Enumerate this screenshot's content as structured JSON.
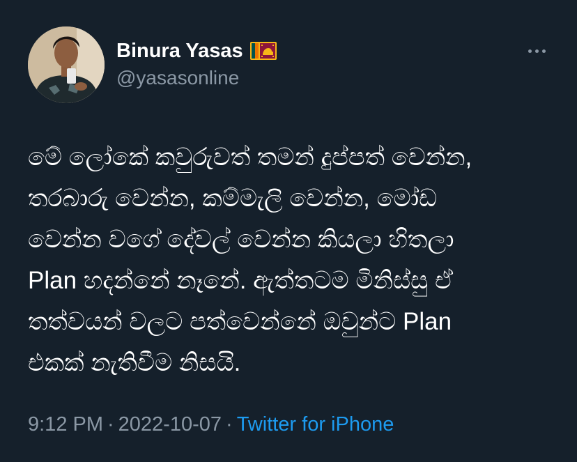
{
  "author": {
    "display_name": "Binura Yasas",
    "handle": "@yasasonline",
    "flag_icon": "sri-lanka-flag-icon",
    "avatar_icon": "profile-photo"
  },
  "menu": {
    "more_icon": "more-horizontal-icon"
  },
  "tweet": {
    "lines": [
      "මේ ලෝකේ කවුරුවත් තමන් දුප්පත් වෙන්න,",
      "තරබාරු වෙන්න, කම්මැලි වෙන්න, මෝඩ",
      "වෙන්න වගේ දේවල් වෙන්න කියලා හිතලා",
      "Plan හදන්නේ නෑනේ. ඇත්තටම මිනිස්සු ඒ",
      "තත්වයන් වලට පත්වෙන්නේ ඔවුන්ට Plan",
      "එකක් නැතිවීම නිසයි."
    ]
  },
  "meta": {
    "time": "9:12 PM",
    "separator": "·",
    "date": "2022-10-07",
    "source": "Twitter for iPhone"
  },
  "colors": {
    "background": "#15202b",
    "primary_text": "#ffffff",
    "secondary_text": "#8b98a5",
    "link": "#1d9bf0"
  }
}
